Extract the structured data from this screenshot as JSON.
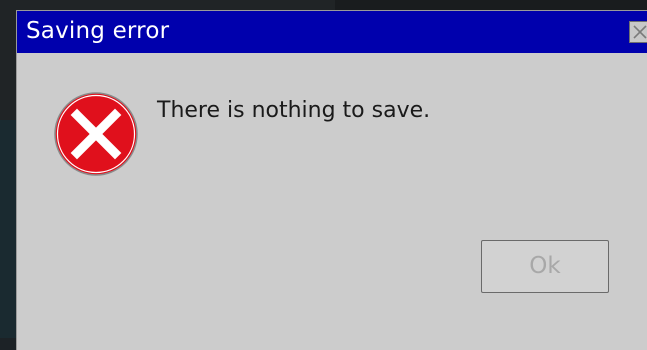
{
  "dialog": {
    "title": "Saving error",
    "message": "There is nothing to save.",
    "ok_label": "Ok",
    "icon": "error-icon",
    "close_icon": "close-icon"
  },
  "colors": {
    "titlebar": "#0000ad",
    "dialog_background": "#cccccc",
    "error_red": "#e0101c",
    "ok_text_disabled": "#a8a8a8"
  }
}
